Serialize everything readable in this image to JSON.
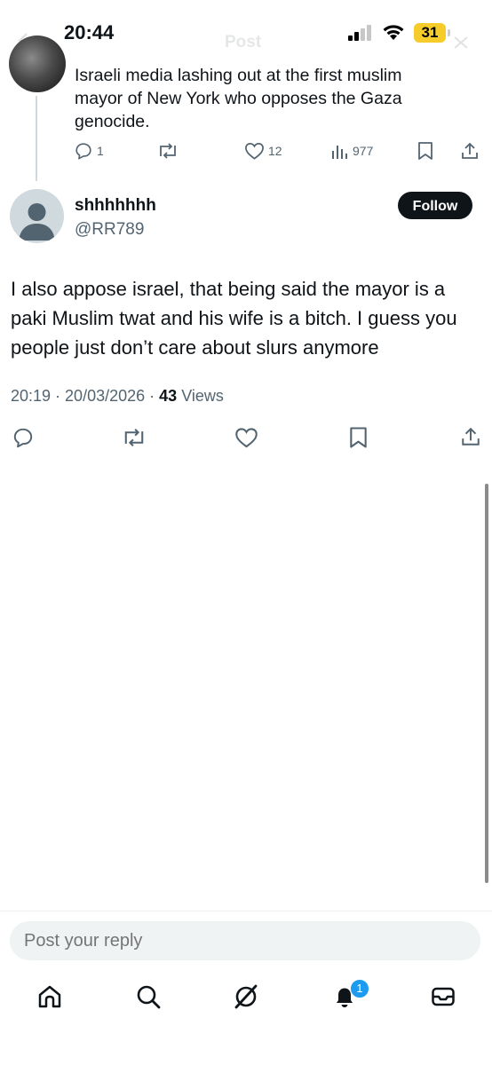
{
  "status_bar": {
    "time": "20:44",
    "battery": "31"
  },
  "header": {
    "title": "Post"
  },
  "parent_tweet": {
    "text": "Israeli media lashing out at the first muslim mayor of New York who opposes the Gaza genocide.",
    "replies": "1",
    "likes": "12",
    "views": "977"
  },
  "tweet": {
    "display_name": "shhhhhhh",
    "handle": "@RR789",
    "follow_label": "Follow",
    "text": "I also appose israel, that being said the mayor is a paki Muslim twat and his wife is a bitch. I guess you people just don’t care about slurs anymore",
    "time": "20:19",
    "date": "20/03/2026",
    "views_count": "43",
    "views_label": "Views"
  },
  "reply": {
    "placeholder": "Post your reply"
  },
  "nav": {
    "notification_count": "1"
  },
  "colors": {
    "accent": "#1d9bf0",
    "text": "#0f1419",
    "secondary": "#536471",
    "battery": "#f5cc2a"
  }
}
